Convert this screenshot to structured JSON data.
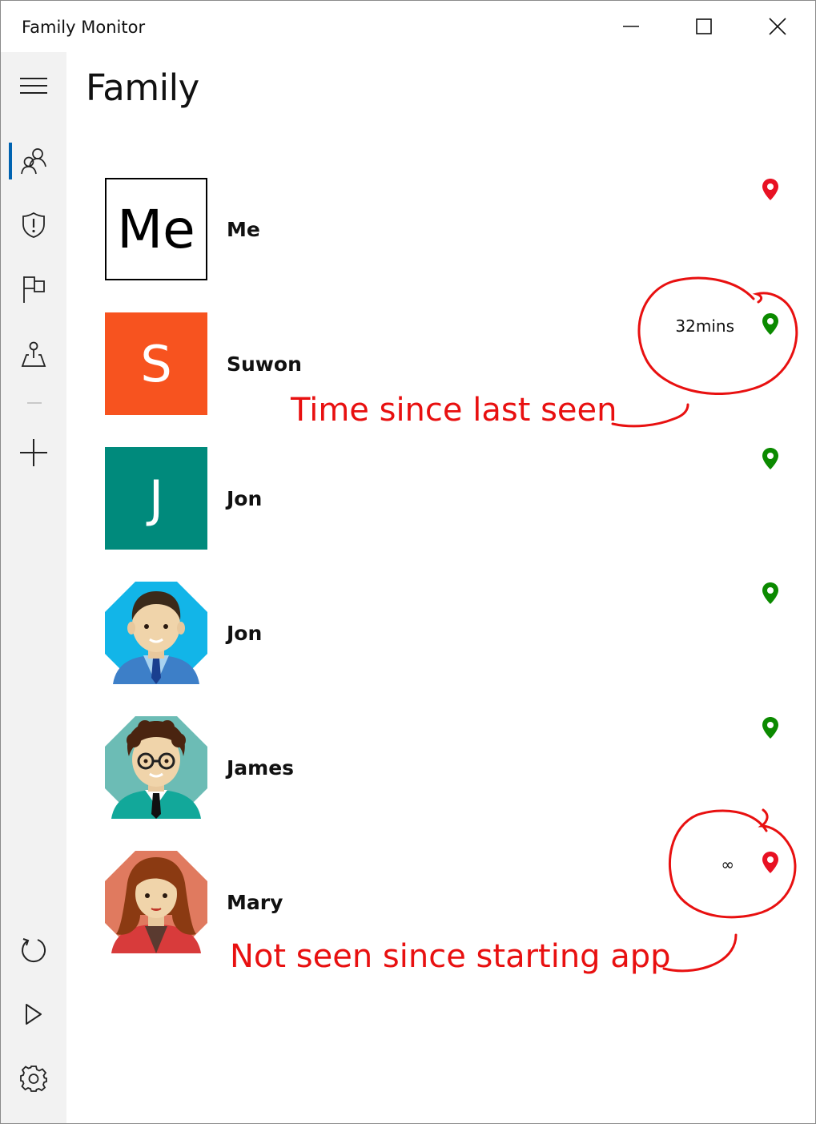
{
  "window": {
    "title": "Family Monitor",
    "controls": {
      "minimize": "minimize",
      "maximize": "maximize",
      "close": "close"
    }
  },
  "nav": {
    "items": [
      {
        "name": "menu",
        "icon": "hamburger-icon"
      },
      {
        "name": "family",
        "icon": "people-icon",
        "selected": true
      },
      {
        "name": "safety",
        "icon": "shield-icon"
      },
      {
        "name": "flag",
        "icon": "flag-icon"
      },
      {
        "name": "map",
        "icon": "location-icon"
      },
      {
        "name": "add",
        "icon": "plus-icon"
      },
      {
        "name": "refresh",
        "icon": "refresh-icon"
      },
      {
        "name": "play",
        "icon": "play-icon"
      },
      {
        "name": "settings",
        "icon": "gear-icon"
      }
    ],
    "accent_color": "#0063b1"
  },
  "page": {
    "title": "Family"
  },
  "members": [
    {
      "name": "Me",
      "avatar_text": "Me",
      "last_seen": "",
      "pin_color": "#e81123"
    },
    {
      "name": "Suwon",
      "avatar_text": "S",
      "avatar_color": "#f7531f",
      "last_seen": "32mins",
      "pin_color": "#0b8a00"
    },
    {
      "name": "Jon",
      "avatar_text": "J",
      "avatar_color": "#008a7c",
      "last_seen": "",
      "pin_color": "#0b8a00"
    },
    {
      "name": "Jon",
      "avatar_icon": "man-blue-suit-avatar",
      "last_seen": "",
      "pin_color": "#0b8a00"
    },
    {
      "name": "James",
      "avatar_icon": "man-glasses-avatar",
      "last_seen": "",
      "pin_color": "#0b8a00"
    },
    {
      "name": "Mary",
      "avatar_icon": "woman-avatar",
      "last_seen": "∞",
      "pin_color": "#e81123"
    }
  ],
  "annotations": {
    "time_since": "Time since last seen",
    "not_seen": "Not seen since starting app",
    "color": "#e81010"
  }
}
